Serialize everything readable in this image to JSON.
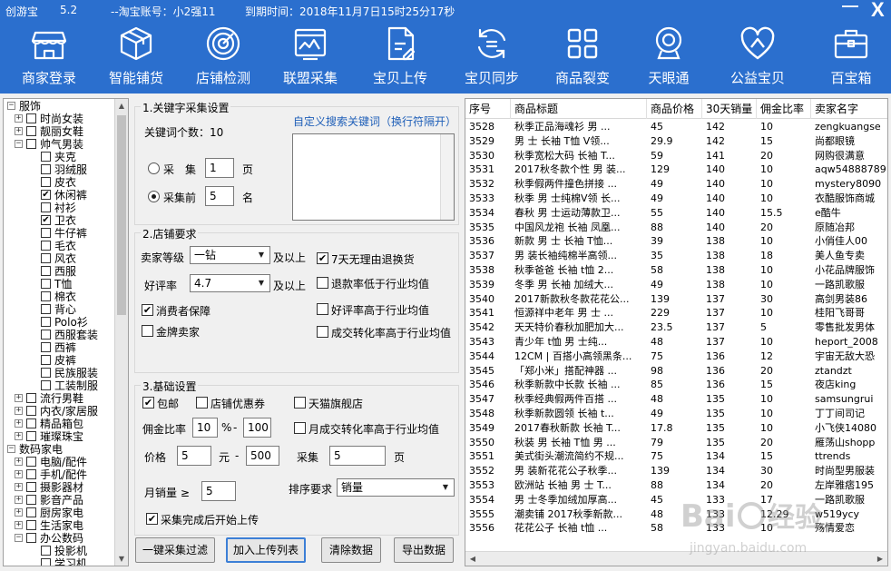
{
  "app": {
    "name": "创游宝",
    "version": "5.2",
    "account": "--淘宝账号：小2强11",
    "expiry": "到期时间：2018年11月7日15时25分17秒"
  },
  "window": {
    "min_icon": "minimize-icon",
    "close_icon": "close-icon",
    "close_glyph": "X",
    "min_glyph": "—"
  },
  "toolbar": [
    {
      "label": "商家登录",
      "icon": "storefront-icon"
    },
    {
      "label": "智能铺货",
      "icon": "box-icon"
    },
    {
      "label": "店铺检测",
      "icon": "radar-icon"
    },
    {
      "label": "联盟采集",
      "icon": "chart-window-icon"
    },
    {
      "label": "宝贝上传",
      "icon": "document-edit-icon"
    },
    {
      "label": "宝贝同步",
      "icon": "sync-icon"
    },
    {
      "label": "商品裂变",
      "icon": "grid-icon"
    },
    {
      "label": "天眼通",
      "icon": "webcam-icon"
    },
    {
      "label": "公益宝贝",
      "icon": "heart-ribbon-icon"
    },
    {
      "label": "百宝箱",
      "icon": "toolbox-icon"
    }
  ],
  "tree": [
    {
      "label": "服饰",
      "level": 0,
      "expander": "−",
      "checkbox": false
    },
    {
      "label": "时尚女装",
      "level": 1,
      "expander": "+",
      "checkbox": true,
      "checked": false
    },
    {
      "label": "靓丽女鞋",
      "level": 1,
      "expander": "+",
      "checkbox": true,
      "checked": false
    },
    {
      "label": "帅气男装",
      "level": 1,
      "expander": "−",
      "checkbox": true,
      "checked": false
    },
    {
      "label": "夹克",
      "level": 2,
      "checkbox": true,
      "checked": false
    },
    {
      "label": "羽绒服",
      "level": 2,
      "checkbox": true,
      "checked": false
    },
    {
      "label": "皮衣",
      "level": 2,
      "checkbox": true,
      "checked": false
    },
    {
      "label": "休闲裤",
      "level": 2,
      "checkbox": true,
      "checked": true
    },
    {
      "label": "衬衫",
      "level": 2,
      "checkbox": true,
      "checked": false
    },
    {
      "label": "卫衣",
      "level": 2,
      "checkbox": true,
      "checked": true
    },
    {
      "label": "牛仔裤",
      "level": 2,
      "checkbox": true,
      "checked": false
    },
    {
      "label": "毛衣",
      "level": 2,
      "checkbox": true,
      "checked": false
    },
    {
      "label": "风衣",
      "level": 2,
      "checkbox": true,
      "checked": false
    },
    {
      "label": "西服",
      "level": 2,
      "checkbox": true,
      "checked": false
    },
    {
      "label": "T恤",
      "level": 2,
      "checkbox": true,
      "checked": false
    },
    {
      "label": "棉衣",
      "level": 2,
      "checkbox": true,
      "checked": false
    },
    {
      "label": "背心",
      "level": 2,
      "checkbox": true,
      "checked": false
    },
    {
      "label": "Polo衫",
      "level": 2,
      "checkbox": true,
      "checked": false
    },
    {
      "label": "西服套装",
      "level": 2,
      "checkbox": true,
      "checked": false
    },
    {
      "label": "西裤",
      "level": 2,
      "checkbox": true,
      "checked": false
    },
    {
      "label": "皮裤",
      "level": 2,
      "checkbox": true,
      "checked": false
    },
    {
      "label": "民族服装",
      "level": 2,
      "checkbox": true,
      "checked": false
    },
    {
      "label": "工装制服",
      "level": 2,
      "checkbox": true,
      "checked": false
    },
    {
      "label": "流行男鞋",
      "level": 1,
      "expander": "+",
      "checkbox": true,
      "checked": false
    },
    {
      "label": "内衣/家居服",
      "level": 1,
      "expander": "+",
      "checkbox": true,
      "checked": false
    },
    {
      "label": "精品箱包",
      "level": 1,
      "expander": "+",
      "checkbox": true,
      "checked": false
    },
    {
      "label": "璀璨珠宝",
      "level": 1,
      "expander": "+",
      "checkbox": true,
      "checked": false
    },
    {
      "label": "数码家电",
      "level": 0,
      "expander": "−",
      "checkbox": false
    },
    {
      "label": "电脑/配件",
      "level": 1,
      "expander": "+",
      "checkbox": true,
      "checked": false
    },
    {
      "label": "手机/配件",
      "level": 1,
      "expander": "+",
      "checkbox": true,
      "checked": false
    },
    {
      "label": "摄影器材",
      "level": 1,
      "expander": "+",
      "checkbox": true,
      "checked": false
    },
    {
      "label": "影音产品",
      "level": 1,
      "expander": "+",
      "checkbox": true,
      "checked": false
    },
    {
      "label": "厨房家电",
      "level": 1,
      "expander": "+",
      "checkbox": true,
      "checked": false
    },
    {
      "label": "生活家电",
      "level": 1,
      "expander": "+",
      "checkbox": true,
      "checked": false
    },
    {
      "label": "办公数码",
      "level": 1,
      "expander": "−",
      "checkbox": true,
      "checked": false
    },
    {
      "label": "投影机",
      "level": 2,
      "checkbox": true,
      "checked": false
    },
    {
      "label": "学习机",
      "level": 2,
      "checkbox": true,
      "checked": false
    }
  ],
  "keyword_section": {
    "legend": "1.关键字采集设置",
    "custom_link": "自定义搜索关键词（换行符隔开）",
    "keyword_count_label": "关键词个数：10",
    "radio_collect_label": "采　集",
    "radio_collect_value": "1",
    "radio_collect_unit": "页",
    "radio_top_label": "采集前",
    "radio_top_value": "5",
    "radio_top_unit": "名",
    "selected_radio": "top"
  },
  "shop_section": {
    "legend": "2.店铺要求",
    "seller_level_label": "卖家等级",
    "seller_level_value": "一钻",
    "seller_level_suffix": "及以上",
    "rating_label": "好评率",
    "rating_value": "4.7",
    "rating_suffix": "及以上",
    "checkboxes": [
      {
        "label": "7天无理由退换货",
        "checked": true
      },
      {
        "label": "退款率低于行业均值",
        "checked": false
      },
      {
        "label": "好评率高于行业均值",
        "checked": false
      },
      {
        "label": "成交转化率高于行业均值",
        "checked": false
      },
      {
        "label": "消费者保障",
        "checked": true
      },
      {
        "label": "金牌卖家",
        "checked": false
      }
    ]
  },
  "basic_section": {
    "legend": "3.基础设置",
    "free_shipping_label": "包邮",
    "free_shipping_checked": true,
    "shop_coupon_label": "店铺优惠券",
    "shop_coupon_checked": false,
    "tmall_label": "天猫旗舰店",
    "tmall_checked": false,
    "commission_label": "佣金比率",
    "commission_min": "10",
    "commission_pct": "%",
    "commission_dash": "-",
    "commission_max": "100",
    "monthly_conv_label": "月成交转化率高于行业均值",
    "monthly_conv_checked": false,
    "price_label": "价格",
    "price_min": "5",
    "price_unit": "元",
    "price_dash": "-",
    "price_max": "500",
    "collect_label": "采集",
    "collect_value": "5",
    "collect_unit": "页",
    "monthly_sales_label": "月销量 ≥",
    "monthly_sales_value": "5",
    "sort_label": "排序要求",
    "sort_value": "销量",
    "auto_upload_label": "采集完成后开始上传",
    "auto_upload_checked": true
  },
  "buttons": {
    "filter": "一键采集过滤",
    "add_upload": "加入上传列表",
    "clear": "清除数据",
    "export": "导出数据"
  },
  "grid": {
    "columns": [
      "序号",
      "商品标题",
      "商品价格",
      "30天销量",
      "佣金比率",
      "卖家名字"
    ],
    "rows": [
      [
        "3528",
        "秋季正品海魂衫 男 ...",
        "45",
        "142",
        "10",
        "zengkuangse"
      ],
      [
        "3529",
        "男 士 长袖 T恤 V领...",
        "29.9",
        "142",
        "15",
        "尚都眼镜"
      ],
      [
        "3530",
        "秋季宽松大码 长袖 T...",
        "59",
        "141",
        "20",
        "网购很满意"
      ],
      [
        "3531",
        "2017秋冬款个性 男 装...",
        "129",
        "140",
        "10",
        "aqw54888789"
      ],
      [
        "3532",
        "秋季假两件撞色拼接 ...",
        "49",
        "140",
        "10",
        "mystery8090"
      ],
      [
        "3533",
        "秋季 男 士纯棉V领 长...",
        "49",
        "140",
        "10",
        "衣酷服饰商城"
      ],
      [
        "3534",
        "春秋 男 士运动薄款卫...",
        "55",
        "140",
        "15.5",
        "e酷牛"
      ],
      [
        "3535",
        "中国风龙袍 长袖 凤凰...",
        "88",
        "140",
        "20",
        "原随冶邦"
      ],
      [
        "3536",
        "新款 男 士 长袖 T恤...",
        "39",
        "138",
        "10",
        "小俏佳人00"
      ],
      [
        "3537",
        "男 装长袖纯棉半高领...",
        "35",
        "138",
        "18",
        "美人鱼专卖"
      ],
      [
        "3538",
        "秋季爸爸 长袖 t恤 2...",
        "58",
        "138",
        "10",
        "小花品牌服饰"
      ],
      [
        "3539",
        "冬季 男 长袖 加绒大...",
        "49",
        "138",
        "10",
        "一路凯歌服"
      ],
      [
        "3540",
        "2017新款秋冬款花花公...",
        "139",
        "137",
        "30",
        "高剑男装86"
      ],
      [
        "3541",
        "恒源祥中老年 男 士 ...",
        "229",
        "137",
        "10",
        "桂阳飞哥哥"
      ],
      [
        "3542",
        "天天特价春秋加肥加大...",
        "23.5",
        "137",
        "5",
        "零售批发男体"
      ],
      [
        "3543",
        "青少年 t恤 男 士纯...",
        "48",
        "137",
        "10",
        "heport_2008"
      ],
      [
        "3544",
        "12CM | 百搭小高领黑条...",
        "75",
        "136",
        "12",
        "宇宙无敌大恐"
      ],
      [
        "3545",
        "「郑小米」搭配神器 ...",
        "98",
        "136",
        "20",
        "ztandzt"
      ],
      [
        "3546",
        "秋季新款中长款 长袖 ...",
        "85",
        "136",
        "15",
        "夜店king"
      ],
      [
        "3547",
        "秋季经典假两件百搭 ...",
        "48",
        "135",
        "10",
        "samsungrui"
      ],
      [
        "3548",
        "秋季新款圆领 长袖 t...",
        "49",
        "135",
        "10",
        "丁丁间司记"
      ],
      [
        "3549",
        "2017春秋新款 长袖 T...",
        "17.8",
        "135",
        "10",
        "小飞侠14080"
      ],
      [
        "3550",
        "秋装 男 长袖 T恤 男 ...",
        "79",
        "135",
        "20",
        "雁荡山shopp"
      ],
      [
        "3551",
        "美式街头潮流简约不规...",
        "75",
        "134",
        "15",
        "ttrends"
      ],
      [
        "3552",
        "男 装新花花公子秋季...",
        "139",
        "134",
        "30",
        "时尚型男服装"
      ],
      [
        "3553",
        "欧洲站 长袖 男 士 T...",
        "88",
        "134",
        "20",
        "左岸雅痞195"
      ],
      [
        "3554",
        "男 士冬季加绒加厚高...",
        "45",
        "133",
        "17",
        "一路凯歌服"
      ],
      [
        "3555",
        "潮卖铺 2017秋季新款...",
        "48",
        "133",
        "12.29",
        "w519ycy"
      ],
      [
        "3556",
        "花花公子 长袖 t恤 ...",
        "58",
        "133",
        "10",
        "殇情爱恋"
      ]
    ]
  }
}
